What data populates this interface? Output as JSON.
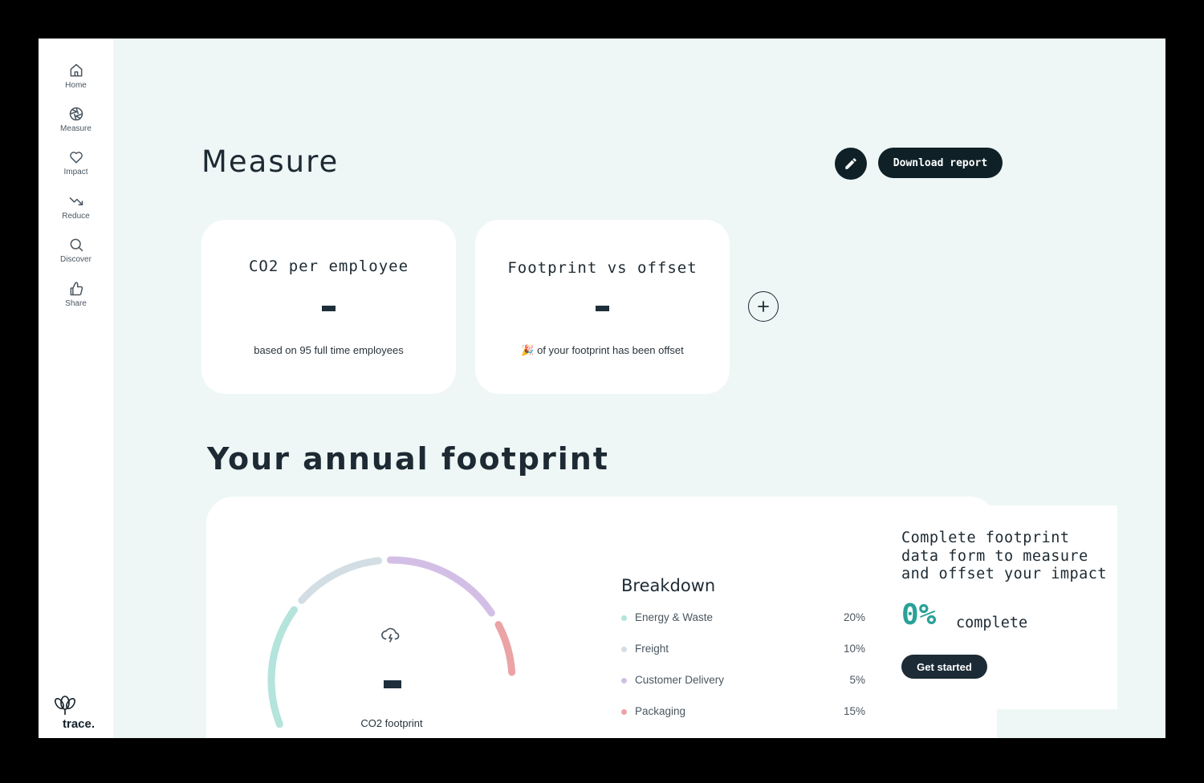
{
  "sidebar": {
    "items": [
      {
        "label": "Home",
        "icon": "home-icon"
      },
      {
        "label": "Measure",
        "icon": "aperture-icon"
      },
      {
        "label": "Impact",
        "icon": "heart-icon"
      },
      {
        "label": "Reduce",
        "icon": "trending-down-icon"
      },
      {
        "label": "Discover",
        "icon": "search-icon"
      },
      {
        "label": "Share",
        "icon": "thumbs-up-icon"
      }
    ],
    "logo_text": "trace."
  },
  "header": {
    "title": "Measure",
    "download_label": "Download report"
  },
  "cards": [
    {
      "title": "CO2 per employee",
      "value": "-",
      "subtitle": "based on 95 full time  employees"
    },
    {
      "title": "Footprint vs offset",
      "value": "-",
      "emoji": "🎉",
      "subtitle": "of your footprint has been offset"
    }
  ],
  "footprint": {
    "title": "Your annual footprint",
    "donut_value": "-",
    "donut_label": "CO2 footprint",
    "breakdown_title": "Breakdown",
    "breakdown": [
      {
        "name": "Energy & Waste",
        "pct": "20%",
        "color": "#b4e4dc"
      },
      {
        "name": "Freight",
        "pct": "10%",
        "color": "#d3dde4"
      },
      {
        "name": "Customer Delivery",
        "pct": "5%",
        "color": "#d3bfe6"
      },
      {
        "name": "Packaging",
        "pct": "15%",
        "color": "#eba3a6"
      }
    ]
  },
  "promo": {
    "text": "Complete footprint data form to measure and offset your impact",
    "percent": "0%",
    "complete_label": "complete",
    "button_label": "Get started"
  },
  "colors": {
    "accent": "#2aa198",
    "dark": "#0f2127",
    "background": "#eef7f6"
  }
}
